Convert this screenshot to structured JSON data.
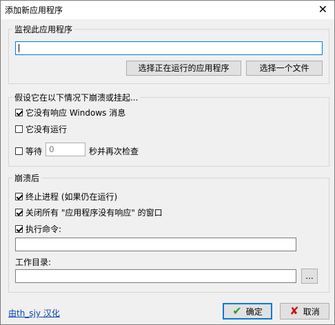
{
  "window": {
    "title": "添加新应用程序",
    "close_glyph": "✕"
  },
  "monitor_group": {
    "label": "监视此应用程序",
    "app_value": "",
    "select_running_label": "选择正在运行的应用程序",
    "select_file_label": "选择一个文件"
  },
  "condition_group": {
    "label": "假设它在以下情况下崩溃或挂起...",
    "not_responding": {
      "label": "它没有响应 Windows 消息",
      "checked": true
    },
    "not_running": {
      "label": "它没有运行",
      "checked": false
    },
    "wait": {
      "label": "等待",
      "checked": false,
      "seconds": "0",
      "suffix": "秒并再次检查"
    }
  },
  "after_group": {
    "label": "崩溃后",
    "terminate": {
      "label": "终止进程 (如果仍在运行)",
      "checked": true
    },
    "close_windows": {
      "label": "关闭所有 \"应用程序没有响应\" 的窗口",
      "checked": true
    },
    "run_command": {
      "label": "执行命令:",
      "checked": true
    },
    "command_value": "",
    "workdir_label": "工作目录:",
    "workdir_value": "",
    "browse_label": "..."
  },
  "footer": {
    "credit_link": "由th_sjy 汉化",
    "ok_label": "确定",
    "cancel_label": "取消"
  },
  "icons": {
    "ok": "check-icon",
    "cancel": "x-icon"
  },
  "colors": {
    "focus_border": "#0078d7",
    "ok_check": "#1ea32b",
    "cancel_x": "#c91717",
    "link": "#0645ad"
  }
}
